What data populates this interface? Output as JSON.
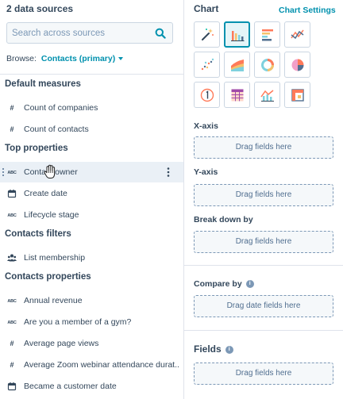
{
  "sources": {
    "title": "2 data sources",
    "search_placeholder": "Search across sources",
    "browse_label": "Browse:",
    "browse_value": "Contacts (primary)"
  },
  "sections": [
    {
      "heading": "Default measures",
      "items": [
        {
          "icon": "#",
          "label": "Count of companies"
        },
        {
          "icon": "#",
          "label": "Count of contacts"
        }
      ]
    },
    {
      "heading": "Top properties",
      "items": [
        {
          "icon": "abc",
          "label": "Contact owner"
        },
        {
          "icon": "calendar",
          "label": "Create date"
        },
        {
          "icon": "abc",
          "label": "Lifecycle stage"
        }
      ]
    },
    {
      "heading": "Contacts filters",
      "items": [
        {
          "icon": "people",
          "label": "List membership"
        }
      ]
    },
    {
      "heading": "Contacts properties",
      "items": [
        {
          "icon": "abc",
          "label": "Annual revenue"
        },
        {
          "icon": "abc",
          "label": "Are you a member of a gym?"
        },
        {
          "icon": "#",
          "label": "Average page views"
        },
        {
          "icon": "#",
          "label": "Average Zoom webinar attendance durat..."
        },
        {
          "icon": "calendar",
          "label": "Became a customer date"
        }
      ]
    }
  ],
  "icon_text": {
    "hash": "#",
    "abc": "ABC"
  },
  "chart": {
    "title": "Chart",
    "settings_link": "Chart Settings",
    "types": [
      "magic-wand",
      "bar",
      "horizontal-bar",
      "line",
      "scatter",
      "area",
      "donut",
      "pie",
      "kpi",
      "table",
      "combo",
      "pivot"
    ],
    "selected_type": "bar",
    "accent_color": "#0091ae"
  },
  "zones": {
    "x_axis": {
      "label": "X-axis",
      "placeholder": "Drag fields here"
    },
    "y_axis": {
      "label": "Y-axis",
      "placeholder": "Drag fields here"
    },
    "break_down": {
      "label": "Break down by",
      "placeholder": "Drag fields here"
    },
    "compare": {
      "label": "Compare by",
      "placeholder": "Drag date fields here"
    },
    "fields": {
      "label": "Fields",
      "placeholder": "Drag fields here"
    }
  }
}
